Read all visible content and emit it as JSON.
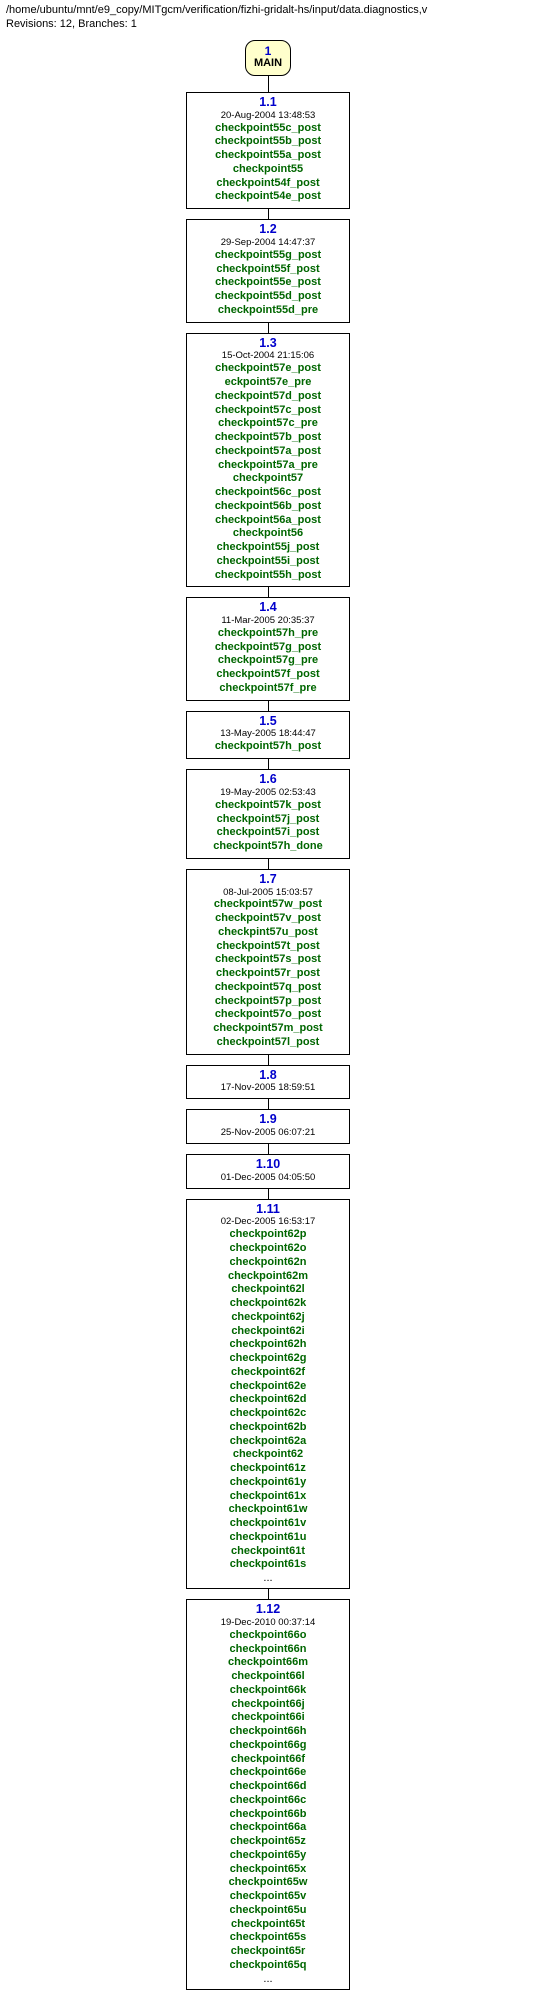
{
  "header": {
    "path": "/home/ubuntu/mnt/e9_copy/MITgcm/verification/fizhi-gridalt-hs/input/data.diagnostics,v",
    "stats": "Revisions: 12, Branches: 1"
  },
  "root": {
    "num": "1",
    "label": "MAIN"
  },
  "nodes": [
    {
      "ver": "1.1",
      "date": "20-Aug-2004 13:48:53",
      "tags": [
        "checkpoint55c_post",
        "checkpoint55b_post",
        "checkpoint55a_post",
        "checkpoint55",
        "checkpoint54f_post",
        "checkpoint54e_post"
      ]
    },
    {
      "ver": "1.2",
      "date": "29-Sep-2004 14:47:37",
      "tags": [
        "checkpoint55g_post",
        "checkpoint55f_post",
        "checkpoint55e_post",
        "checkpoint55d_post",
        "checkpoint55d_pre"
      ]
    },
    {
      "ver": "1.3",
      "date": "15-Oct-2004 21:15:06",
      "tags": [
        "checkpoint57e_post",
        "eckpoint57e_pre",
        "checkpoint57d_post",
        "checkpoint57c_post",
        "checkpoint57c_pre",
        "checkpoint57b_post",
        "checkpoint57a_post",
        "checkpoint57a_pre",
        "checkpoint57",
        "checkpoint56c_post",
        "checkpoint56b_post",
        "checkpoint56a_post",
        "checkpoint56",
        "checkpoint55j_post",
        "checkpoint55i_post",
        "checkpoint55h_post"
      ]
    },
    {
      "ver": "1.4",
      "date": "11-Mar-2005 20:35:37",
      "tags": [
        "checkpoint57h_pre",
        "checkpoint57g_post",
        "checkpoint57g_pre",
        "checkpoint57f_post",
        "checkpoint57f_pre"
      ]
    },
    {
      "ver": "1.5",
      "date": "13-May-2005 18:44:47",
      "tags": [
        "checkpoint57h_post"
      ]
    },
    {
      "ver": "1.6",
      "date": "19-May-2005 02:53:43",
      "tags": [
        "checkpoint57k_post",
        "checkpoint57j_post",
        "checkpoint57i_post",
        "checkpoint57h_done"
      ]
    },
    {
      "ver": "1.7",
      "date": "08-Jul-2005 15:03:57",
      "tags": [
        "checkpoint57w_post",
        "checkpoint57v_post",
        "checkpint57u_post",
        "checkpoint57t_post",
        "checkpoint57s_post",
        "checkpoint57r_post",
        "checkpoint57q_post",
        "checkpoint57p_post",
        "checkpoint57o_post",
        "checkpoint57m_post",
        "checkpoint57l_post"
      ]
    },
    {
      "ver": "1.8",
      "date": "17-Nov-2005 18:59:51",
      "tags": []
    },
    {
      "ver": "1.9",
      "date": "25-Nov-2005 06:07:21",
      "tags": []
    },
    {
      "ver": "1.10",
      "date": "01-Dec-2005 04:05:50",
      "tags": []
    },
    {
      "ver": "1.11",
      "date": "02-Dec-2005 16:53:17",
      "tags": [
        "checkpoint62p",
        "checkpoint62o",
        "checkpoint62n",
        "checkpoint62m",
        "checkpoint62l",
        "checkpoint62k",
        "checkpoint62j",
        "checkpoint62i",
        "checkpoint62h",
        "checkpoint62g",
        "checkpoint62f",
        "checkpoint62e",
        "checkpoint62d",
        "checkpoint62c",
        "checkpoint62b",
        "checkpoint62a",
        "checkpoint62",
        "checkpoint61z",
        "checkpoint61y",
        "checkpoint61x",
        "checkpoint61w",
        "checkpoint61v",
        "checkpoint61u",
        "checkpoint61t",
        "checkpoint61s"
      ],
      "ellipsis": true
    },
    {
      "ver": "1.12",
      "date": "19-Dec-2010 00:37:14",
      "tags": [
        "checkpoint66o",
        "checkpoint66n",
        "checkpoint66m",
        "checkpoint66l",
        "checkpoint66k",
        "checkpoint66j",
        "checkpoint66i",
        "checkpoint66h",
        "checkpoint66g",
        "checkpoint66f",
        "checkpoint66e",
        "checkpoint66d",
        "checkpoint66c",
        "checkpoint66b",
        "checkpoint66a",
        "checkpoint65z",
        "checkpoint65y",
        "checkpoint65x",
        "checkpoint65w",
        "checkpoint65v",
        "checkpoint65u",
        "checkpoint65t",
        "checkpoint65s",
        "checkpoint65r",
        "checkpoint65q"
      ],
      "ellipsis": true
    }
  ]
}
